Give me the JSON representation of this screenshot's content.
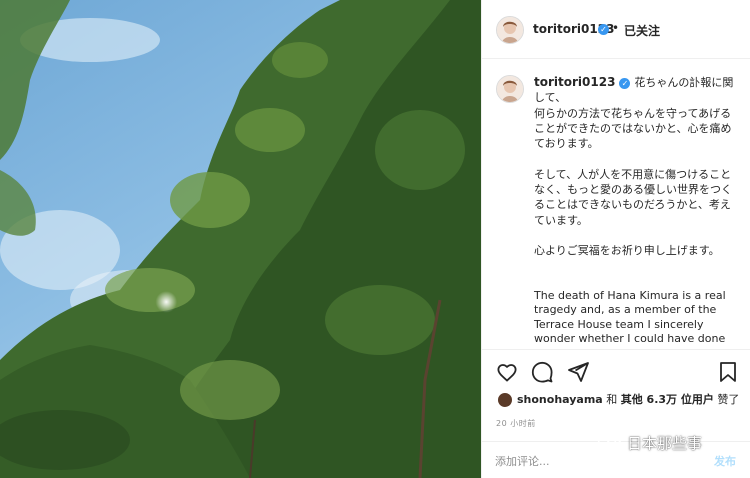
{
  "post": {
    "username": "toritori0123",
    "follow_status": "已关注",
    "caption_ja_1": "花ちゃんの訃報に関して、\n何らかの方法で花ちゃんを守ってあげることができたのではないかと、心を痛めております。",
    "caption_ja_2": "そして、人が人を不用意に傷つけることなく、もっと愛のある優しい世界をつくることはできないものだろうかと、考えています。",
    "caption_ja_3": "心よりご冥福をお祈り申し上げます。",
    "caption_en": "The death of Hana Kimura is a real tragedy and, as a member of the Terrace House team I sincerely wonder whether I could have done"
  },
  "likes": {
    "liker": "shonohayama",
    "text_mid": "和",
    "count_text": "其他 6.3万 位用户",
    "suffix": "赞了"
  },
  "timestamp": "20 小时前",
  "comment": {
    "placeholder": "添加评论...",
    "post_label": "发布"
  },
  "watermark": "日本那些事",
  "icons": {
    "like": "heart-icon",
    "comment": "comment-icon",
    "share": "share-icon",
    "save": "bookmark-icon",
    "verified": "verified-badge-icon"
  },
  "colors": {
    "verified": "#3897f0",
    "text": "#262626",
    "muted": "#8e8e8e",
    "post_disabled": "#b2dffc"
  }
}
